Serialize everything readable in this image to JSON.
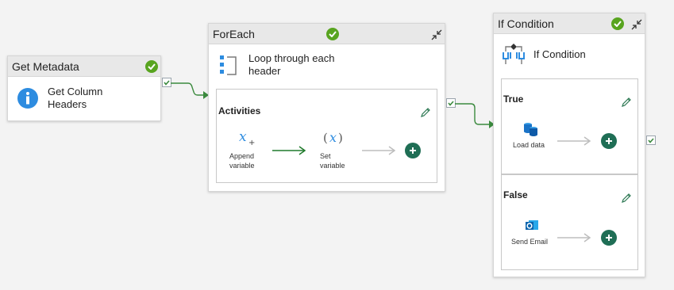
{
  "get_metadata": {
    "title": "Get Metadata",
    "label": "Get Column Headers"
  },
  "foreach": {
    "title": "ForEach",
    "label": "Loop through each header",
    "activities_label": "Activities",
    "steps": [
      {
        "label": "Append variable",
        "icon": "append-variable-icon"
      },
      {
        "label": "Set variable",
        "icon": "set-variable-icon"
      }
    ]
  },
  "if_condition": {
    "title": "If Condition",
    "label": "If Condition",
    "true_branch": {
      "label": "True",
      "activity": "Load data",
      "icon": "database-icon"
    },
    "false_branch": {
      "label": "False",
      "activity": "Send Email",
      "icon": "outlook-icon"
    }
  },
  "colors": {
    "success": "#58a41f",
    "connector": "#3b8a3e",
    "add": "#1f6e55",
    "icon_blue": "#2d8ce0"
  }
}
